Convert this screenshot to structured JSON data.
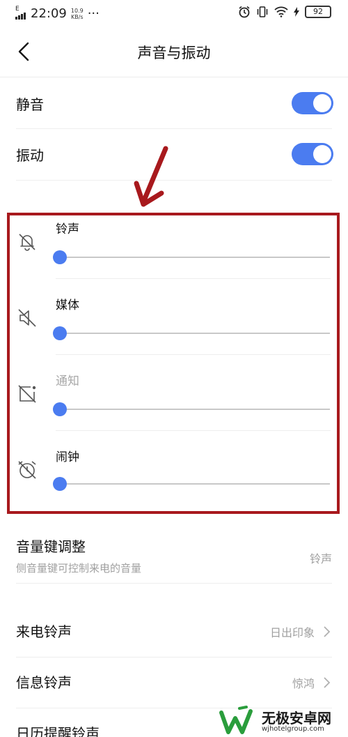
{
  "status_bar": {
    "signal": "E",
    "time": "22:09",
    "net_speed_value": "10.9",
    "net_speed_unit": "KB/s",
    "more": "···",
    "battery": "92"
  },
  "header": {
    "title": "声音与振动"
  },
  "toggles": {
    "mute_label": "静音",
    "mute_on": true,
    "vibrate_label": "振动",
    "vibrate_on": true
  },
  "volumes": [
    {
      "label": "铃声",
      "icon": "bell-muted-icon",
      "level": 0,
      "enabled": true
    },
    {
      "label": "媒体",
      "icon": "speaker-muted-icon",
      "level": 0,
      "enabled": true
    },
    {
      "label": "通知",
      "icon": "notification-muted-icon",
      "level": 0,
      "enabled": false
    },
    {
      "label": "闹钟",
      "icon": "alarm-muted-icon",
      "level": 0,
      "enabled": true
    }
  ],
  "volume_key": {
    "title": "音量键调整",
    "subtitle": "侧音量键可控制来电的音量",
    "value": "铃声"
  },
  "ringtones": [
    {
      "title": "来电铃声",
      "value": "日出印象"
    },
    {
      "title": "信息铃声",
      "value": "惊鸿"
    },
    {
      "title": "日历提醒铃声",
      "value": ""
    }
  ],
  "watermark": {
    "name": "无极安卓网",
    "url": "wjhotelgroup.com"
  },
  "colors": {
    "accent": "#4b7cf0",
    "highlight": "#a8191d"
  }
}
